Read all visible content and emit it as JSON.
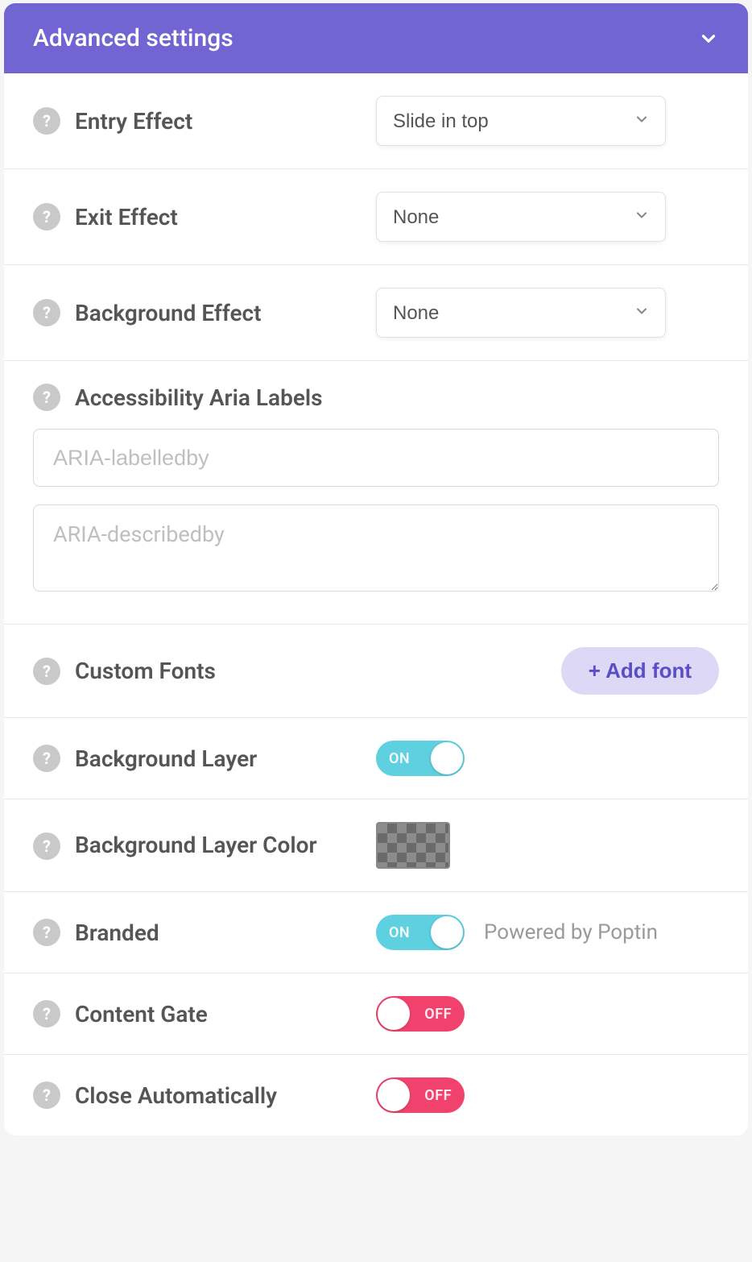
{
  "header": {
    "title": "Advanced settings"
  },
  "rows": {
    "entryEffect": {
      "label": "Entry Effect",
      "value": "Slide in top"
    },
    "exitEffect": {
      "label": "Exit Effect",
      "value": "None"
    },
    "backgroundEffect": {
      "label": "Background Effect",
      "value": "None"
    },
    "accessibility": {
      "label": "Accessibility Aria Labels",
      "labelledbyPlaceholder": "ARIA-labelledby",
      "describedbyPlaceholder": "ARIA-describedby",
      "labelledbyValue": "",
      "describedbyValue": ""
    },
    "customFonts": {
      "label": "Custom Fonts",
      "addButton": "+ Add font"
    },
    "backgroundLayer": {
      "label": "Background Layer",
      "toggle": "ON"
    },
    "backgroundLayerColor": {
      "label": "Background Layer Color"
    },
    "branded": {
      "label": "Branded",
      "toggle": "ON",
      "subtext": "Powered by Poptin"
    },
    "contentGate": {
      "label": "Content Gate",
      "toggle": "OFF"
    },
    "closeAutomatically": {
      "label": "Close Automatically",
      "toggle": "OFF"
    }
  },
  "colors": {
    "headerBg": "#7164d3",
    "toggleOn": "#5fd0df",
    "toggleOff": "#f0426d",
    "addFontBg": "#dcd8f5",
    "addFontText": "#5a4dc9"
  }
}
